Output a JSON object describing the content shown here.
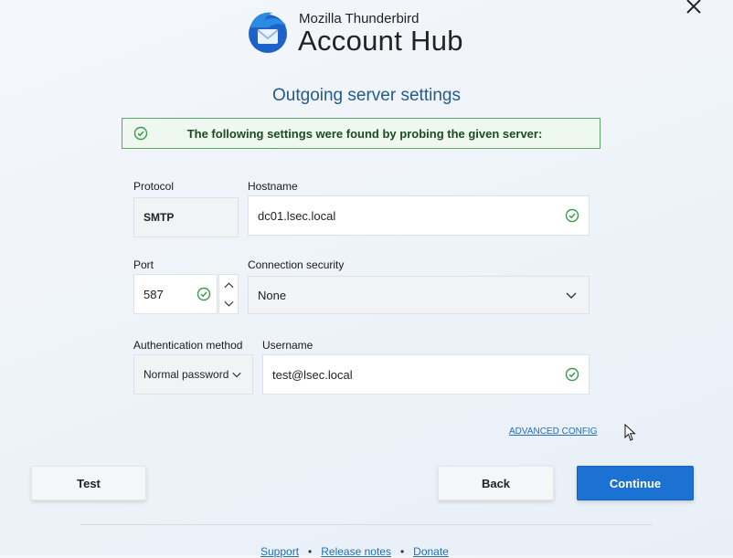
{
  "window": {
    "close_icon": "close-icon"
  },
  "header": {
    "brand_small": "Mozilla Thunderbird",
    "brand_large": "Account Hub",
    "logo_icon": "thunderbird-logo"
  },
  "page": {
    "title": "Outgoing server settings",
    "notice": "The following settings were found by probing the given server:"
  },
  "form": {
    "protocol": {
      "label": "Protocol",
      "value": "SMTP"
    },
    "hostname": {
      "label": "Hostname",
      "value": "dc01.lsec.local"
    },
    "port": {
      "label": "Port",
      "value": "587"
    },
    "connection_security": {
      "label": "Connection security",
      "value": "None"
    },
    "auth_method": {
      "label": "Authentication method",
      "value": "Normal password"
    },
    "username": {
      "label": "Username",
      "value": "test@lsec.local"
    }
  },
  "advanced_link": "ADVANCED CONFIG",
  "buttons": {
    "test": "Test",
    "back": "Back",
    "continue": "Continue"
  },
  "footer": {
    "support": "Support",
    "release_notes": "Release notes",
    "donate": "Donate",
    "separator": "•"
  },
  "colors": {
    "accent": "#1b72d3",
    "heading": "#245b8a",
    "success": "#5aa86a"
  }
}
